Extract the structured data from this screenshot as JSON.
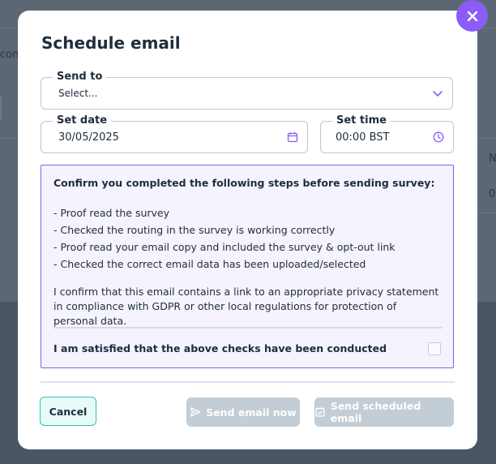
{
  "background": {
    "fragment_left": "con",
    "fragment_right_top": "N",
    "fragment_right_bottom": "0"
  },
  "modal": {
    "title": "Schedule email",
    "close_icon": "close-icon",
    "send_to": {
      "label": "Send to",
      "placeholder": "Select...",
      "icon": "chevron-down-icon"
    },
    "set_date": {
      "label": "Set date",
      "value": "30/05/2025",
      "icon": "calendar-icon"
    },
    "set_time": {
      "label": "Set time",
      "value": "00:00 BST",
      "icon": "clock-icon"
    },
    "checklist": {
      "heading": "Confirm you completed the following steps before sending survey:",
      "items": [
        "- Proof read the survey",
        "- Checked the routing in the survey is working correctly",
        "- Proof read your email copy and included the survey & opt-out link",
        "- Checked the correct email data has been uploaded/selected"
      ],
      "confirmation": "I confirm that this email contains a link to an appropriate privacy statement in compliance with GDPR or other local regulations for protection of personal data.",
      "satisfied_label": "I am satisfied that the above checks have been conducted",
      "checkbox_checked": false
    },
    "buttons": {
      "cancel": "Cancel",
      "send_now": "Send email now",
      "send_scheduled": "Send scheduled email"
    }
  },
  "colors": {
    "accent": "#8b5cf6",
    "cancel_border": "#2bc4b4",
    "disabled_button": "#c2cdd5",
    "overlay": "#4a5663"
  }
}
